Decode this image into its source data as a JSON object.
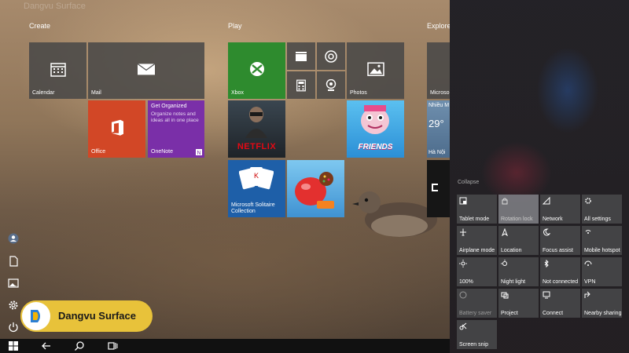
{
  "groups": {
    "create": "Create",
    "play": "Play",
    "explore": "Explore"
  },
  "tiles": {
    "calendar": "Calendar",
    "mail": "Mail",
    "office": "Office",
    "onenote": "OneNote",
    "onenote_title": "Get Organized",
    "onenote_desc": "Organize notes and ideas all in one place",
    "xbox": "Xbox",
    "photos": "Photos",
    "netflix": "NETFLIX",
    "friends": "FRIENDS",
    "solitaire": "Microsoft Solitaire Collection",
    "store": "Microso",
    "weather_label": "Nhiều M",
    "weather_temp": "29°",
    "weather_city": "Hà Nội"
  },
  "action_center": {
    "collapse": "Collapse",
    "quick_actions": [
      {
        "label": "Tablet mode",
        "icon": "tablet-mode-icon",
        "state": "off"
      },
      {
        "label": "Rotation lock",
        "icon": "rotation-lock-icon",
        "state": "on"
      },
      {
        "label": "Network",
        "icon": "network-icon",
        "state": "off"
      },
      {
        "label": "All settings",
        "icon": "settings-icon",
        "state": "off"
      },
      {
        "label": "Airplane mode",
        "icon": "airplane-icon",
        "state": "off"
      },
      {
        "label": "Location",
        "icon": "location-icon",
        "state": "off"
      },
      {
        "label": "Focus assist",
        "icon": "moon-icon",
        "state": "off"
      },
      {
        "label": "Mobile hotspot",
        "icon": "hotspot-icon",
        "state": "off"
      },
      {
        "label": "100%",
        "icon": "brightness-icon",
        "state": "off"
      },
      {
        "label": "Night light",
        "icon": "night-light-icon",
        "state": "off"
      },
      {
        "label": "Not connected",
        "icon": "bluetooth-icon",
        "state": "off"
      },
      {
        "label": "VPN",
        "icon": "vpn-icon",
        "state": "off"
      },
      {
        "label": "Battery saver",
        "icon": "battery-saver-icon",
        "state": "dim"
      },
      {
        "label": "Project",
        "icon": "project-icon",
        "state": "off"
      },
      {
        "label": "Connect",
        "icon": "connect-icon",
        "state": "off"
      },
      {
        "label": "Nearby sharing",
        "icon": "share-icon",
        "state": "off"
      },
      {
        "label": "Screen snip",
        "icon": "snip-icon",
        "state": "off"
      }
    ]
  },
  "watermark": {
    "text": "Dangvu Surface",
    "faint": "Dangvu Surface"
  },
  "colors": {
    "xbox": "#2e8b2e",
    "office": "#d24726",
    "onenote": "#7a2fa8",
    "solitaire": "#1e5fa8",
    "accent": "#e8c23a"
  }
}
